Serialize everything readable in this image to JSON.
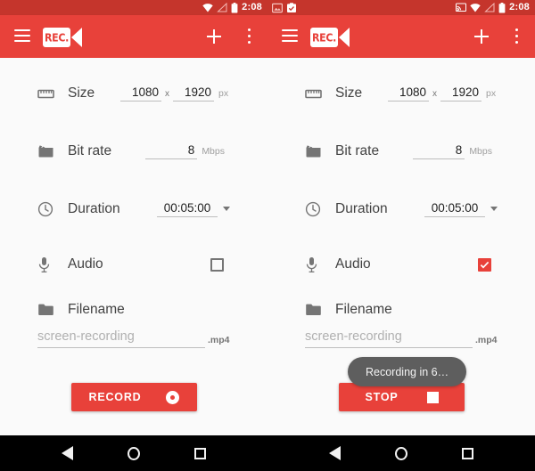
{
  "status_bar": {
    "time": "2:08",
    "left_panel": {
      "notification_icons": [],
      "system_icons": [
        "wifi-icon",
        "cellular-signal-icon",
        "battery-icon"
      ]
    },
    "right_panel": {
      "notification_icons": [
        "image-notification-icon",
        "clipboard-notification-icon"
      ],
      "system_icons": [
        "cast-icon",
        "wifi-icon",
        "cellular-signal-icon",
        "battery-icon"
      ]
    }
  },
  "app_bar": {
    "menu_icon": "hamburger-menu-icon",
    "logo_text": "REC.",
    "add_icon": "plus-icon",
    "overflow_icon": "more-vertical-icon",
    "brand_color": "#e8413a"
  },
  "settings": {
    "size": {
      "label": "Size",
      "icon": "ruler-icon",
      "width": "1080",
      "separator": "x",
      "height": "1920",
      "unit": "px"
    },
    "bitrate": {
      "label": "Bit rate",
      "icon": "clapperboard-icon",
      "value": "8",
      "unit": "Mbps"
    },
    "duration": {
      "label": "Duration",
      "icon": "clock-icon",
      "value": "00:05:00"
    },
    "audio": {
      "label": "Audio",
      "icon": "microphone-icon",
      "checked_left": false,
      "checked_right": true
    },
    "filename": {
      "label": "Filename",
      "icon": "folder-icon",
      "placeholder": "screen-recording",
      "value": "",
      "extension": ".mp4"
    }
  },
  "left_panel": {
    "action_button": {
      "label": "RECORD",
      "icon": "record-dot-icon"
    }
  },
  "right_panel": {
    "action_button": {
      "label": "STOP",
      "icon": "stop-square-icon"
    },
    "toast": {
      "message": "Recording in 6…"
    }
  },
  "nav_bar": {
    "back": "back-triangle-icon",
    "home": "home-circle-icon",
    "recents": "recents-square-icon"
  }
}
